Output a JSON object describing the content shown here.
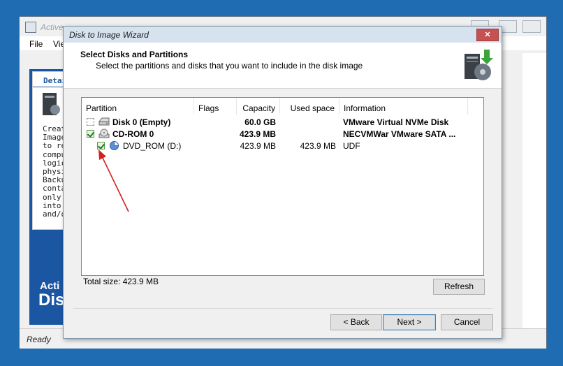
{
  "background_app": {
    "title": "Active",
    "menu": [
      "File",
      "Vie"
    ],
    "side_header": "Detai",
    "side_text": "Creat\nImage\nto re\ncompu\nlogic\nphysi\nBacku\nconta\nonly \ninto \nand/o",
    "brand_line1": "Acti",
    "brand_line2": "Dis",
    "status": "Ready"
  },
  "dialog": {
    "title": "Disk to Image Wizard",
    "close_glyph": "✕",
    "heading": "Select Disks and Partitions",
    "subheading": "Select the partitions and disks that you want to include in the disk image",
    "columns": [
      "Partition",
      "Flags",
      "Capacity",
      "Used space",
      "Information"
    ],
    "rows": [
      {
        "name": "Disk 0 (Empty)",
        "flags": "",
        "capacity": "60.0 GB",
        "used": "",
        "info": "VMware Virtual NVMe Disk",
        "checked": false,
        "bold": true,
        "icon": "hard-disk-icon"
      },
      {
        "name": "CD-ROM 0",
        "flags": "",
        "capacity": "423.9 MB",
        "used": "",
        "info": "NECVMWar VMware SATA ...",
        "checked": true,
        "bold": true,
        "icon": "cdrom-drive-icon"
      },
      {
        "name": "DVD_ROM (D:)",
        "flags": "",
        "capacity": "423.9 MB",
        "used": "423.9 MB",
        "info": "UDF",
        "checked": true,
        "bold": false,
        "icon": "partition-pie-icon"
      }
    ],
    "total_size": "Total size: 423.9 MB",
    "buttons": {
      "refresh": "Refresh",
      "back": "< Back",
      "next": "Next >",
      "cancel": "Cancel"
    }
  },
  "colors": {
    "desktop": "#1f6cb3",
    "annotation_arrow": "#d42020",
    "brand_blue": "#1b56a3"
  }
}
